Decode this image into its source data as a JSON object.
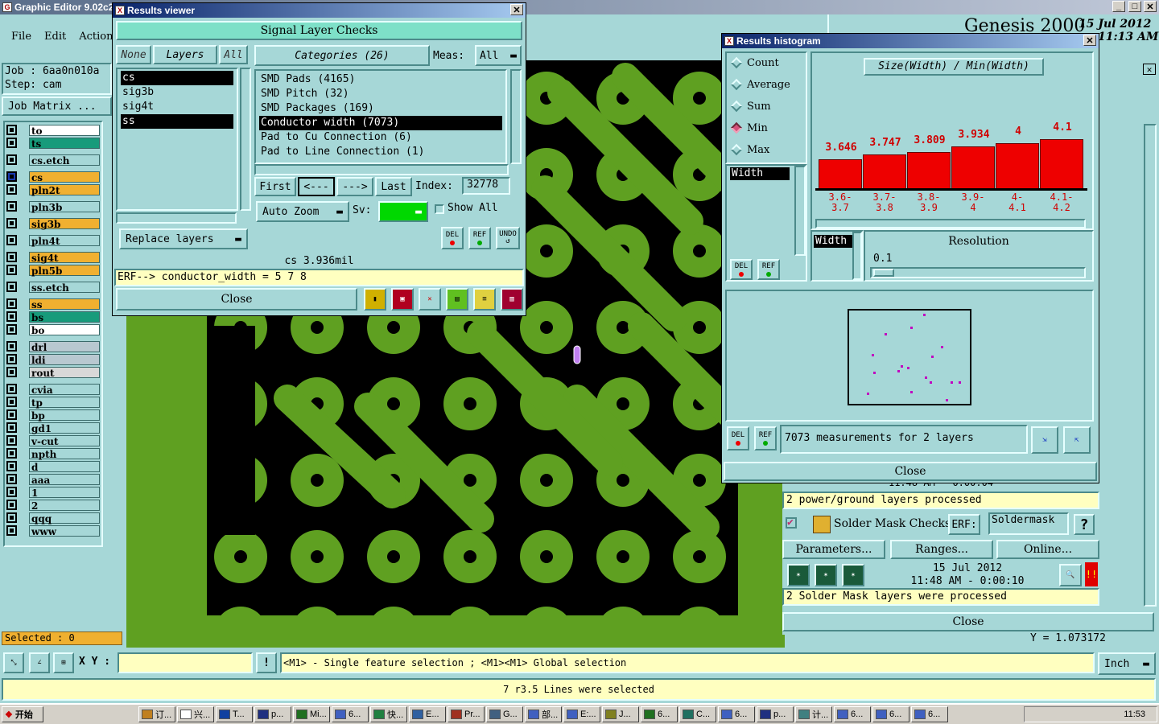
{
  "app": {
    "title": "Graphic Editor 9.02c2",
    "menu": [
      "File",
      "Edit",
      "Action"
    ],
    "job_label": "Job : 6aa0n010a",
    "step_label": "Step: cam",
    "job_matrix_button": "Job Matrix ...",
    "selected_label": "Selected : 0",
    "xy_label": "X Y :",
    "xy_value": "",
    "hint": "<M1> - Single feature selection ; <M1><M1> Global selection",
    "units": "Inch",
    "status": "7 r3.5 Lines were selected",
    "y_readout": "Y = 1.073172",
    "genesis_title": "Genesis 2000",
    "genesis_date": "15 Jul 2012",
    "genesis_time": "11:13 AM"
  },
  "layers": [
    {
      "name": "to",
      "color": "#ffffff"
    },
    {
      "name": "ts",
      "color": "#179b7b"
    },
    {
      "name": "cs.etch",
      "color": "#a6d7d7"
    },
    {
      "name": "cs",
      "color": "#f0b030"
    },
    {
      "name": "pln2t",
      "color": "#f0b030"
    },
    {
      "name": "pln3b",
      "color": "#a6d7d7"
    },
    {
      "name": "sig3b",
      "color": "#f0b030"
    },
    {
      "name": "pln4t",
      "color": "#a6d7d7"
    },
    {
      "name": "sig4t",
      "color": "#f0b030"
    },
    {
      "name": "pln5b",
      "color": "#f0b030"
    },
    {
      "name": "ss.etch",
      "color": "#a6d7d7"
    },
    {
      "name": "ss",
      "color": "#f0b030"
    },
    {
      "name": "bs",
      "color": "#179b7b"
    },
    {
      "name": "bo",
      "color": "#ffffff"
    },
    {
      "name": "drl",
      "color": "#b8c8d0"
    },
    {
      "name": "ldi",
      "color": "#b8c8d0"
    },
    {
      "name": "rout",
      "color": "#d8d8d8"
    },
    {
      "name": "cvia",
      "color": "#a6d7d7"
    },
    {
      "name": "tp",
      "color": "#a6d7d7"
    },
    {
      "name": "bp",
      "color": "#a6d7d7"
    },
    {
      "name": "gd1",
      "color": "#a6d7d7"
    },
    {
      "name": "v-cut",
      "color": "#a6d7d7"
    },
    {
      "name": "npth",
      "color": "#a6d7d7"
    },
    {
      "name": "d",
      "color": "#a6d7d7"
    },
    {
      "name": "aaa",
      "color": "#a6d7d7"
    },
    {
      "name": "1",
      "color": "#a6d7d7"
    },
    {
      "name": "2",
      "color": "#a6d7d7"
    },
    {
      "name": "qqq",
      "color": "#a6d7d7"
    },
    {
      "name": "www",
      "color": "#a6d7d7"
    }
  ],
  "results_viewer": {
    "title": "Results viewer",
    "header": "Signal Layer Checks",
    "none_btn": "None",
    "layers_btn": "Layers",
    "all_btn": "All",
    "layers": [
      "cs",
      "sig3b",
      "sig4t",
      "ss"
    ],
    "categories_btn": "Categories (26)",
    "meas_label": "Meas:",
    "meas_value": "All",
    "categories": [
      "SMD Pads (4165)",
      "SMD Pitch (32)",
      "SMD Packages (169)",
      "Conductor width (7073)",
      "Pad to Cu Connection (6)",
      "Pad to Line Connection (1)"
    ],
    "first_btn": "First",
    "prev_btn": "<---",
    "next_btn": "--->",
    "last_btn": "Last",
    "index_label": "Index:",
    "index_value": "32778",
    "autozoom": "Auto Zoom",
    "sv_label": "Sv:",
    "show_all": "Show All",
    "replace_layers": "Replace layers",
    "info": "cs 3.936mil",
    "erf": "ERF--> conductor_width = 5 7 8",
    "close": "Close"
  },
  "histogram": {
    "title": "Results histogram",
    "options": [
      "Count",
      "Average",
      "Sum",
      "Min",
      "Max"
    ],
    "selected_option": "Min",
    "attr_list": [
      "Width"
    ],
    "chart_title": "Size(Width) / Min(Width)",
    "resolution_label": "Resolution",
    "resolution_value": "0.1",
    "attr_selected": "Width",
    "measurements": "7073 measurements for 2 layers",
    "close": "Close",
    "del": "DEL",
    "ref": "REF"
  },
  "chart_data": {
    "type": "bar",
    "title": "Size(Width) / Min(Width)",
    "categories": [
      "3.6-3.7",
      "3.7-3.8",
      "3.8-3.9",
      "3.9-4",
      "4-4.1",
      "4.1-4.2"
    ],
    "values": [
      3.646,
      3.747,
      3.809,
      3.934,
      4,
      4.1
    ],
    "value_labels": [
      "3.646",
      "3.747",
      "3.809",
      "3.934",
      "4",
      "4.1"
    ],
    "bin_top": [
      "3.6-",
      "3.7-",
      "3.8-",
      "3.9-",
      "4-",
      "4.1-"
    ],
    "bin_bottom": [
      "3.7",
      "3.8",
      "3.9",
      "4",
      "4.1",
      "4.2"
    ],
    "color": "#ee0000"
  },
  "checklist": {
    "time_partial": "11:48 AM - 0:00:04",
    "pg_msg": "2 power/ground layers processed",
    "sm_name": "Solder Mask Checks",
    "erf_label": "ERF:",
    "erf_value": "Soldermask",
    "help": "?",
    "params_btn": "Parameters...",
    "ranges_btn": "Ranges...",
    "online_btn": "Online...",
    "date": "15 Jul 2012",
    "time": "11:48 AM - 0:00:10",
    "sm_msg": "2 Solder Mask layers were processed",
    "close": "Close"
  },
  "taskbar": {
    "start": "开始",
    "clock": "11:53",
    "items": [
      "订...",
      "兴...",
      "T...",
      "p...",
      "Mi...",
      "6...",
      "快...",
      "E...",
      "Pr...",
      "G...",
      "部...",
      "E:...",
      "J...",
      "6...",
      "C...",
      "6...",
      "p...",
      "计...",
      "6...",
      "6...",
      "6..."
    ]
  }
}
